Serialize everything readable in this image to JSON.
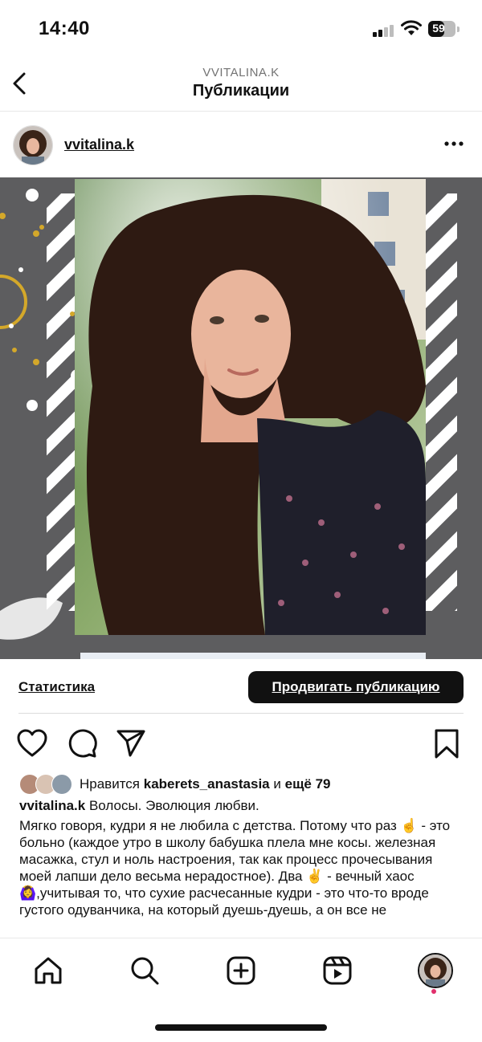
{
  "status_bar": {
    "time": "14:40",
    "battery": "59"
  },
  "nav": {
    "subtitle": "VVITALINA.K",
    "title": "Публикации"
  },
  "post": {
    "username": "vvitalina.k",
    "statistics_label": "Статистика",
    "promote_label": "Продвигать публикацию",
    "likes_prefix": "Нравится",
    "likes_user": "kaberets_anastasia",
    "likes_and": "и",
    "likes_more": "ещё 79",
    "caption_user": "vvitalina.k",
    "caption_title": "Волосы. Эволюция любви.",
    "caption_body": "Мягко говоря, кудри я не любила с детства. Потому что раз ☝️ - это больно (каждое утро в школу бабушка плела мне косы. железная масажка, стул и ноль настроения, так как процесс прочесывания моей лапши дело весьма нерадостное). Два ✌️ - вечный хаос 🙆‍♀️,учитывая то, что сухие расчесанные кудри - это что-то вроде густого одуванчика, на который дуешь-дуешь, а он все не"
  },
  "icons": [
    "back-chevron-icon",
    "more-options-icon",
    "heart-icon",
    "comment-icon",
    "share-icon",
    "bookmark-icon",
    "home-icon",
    "search-icon",
    "create-icon",
    "reels-icon",
    "profile-icon"
  ],
  "colors": {
    "accent_dark": "#111111",
    "notification": "#e1306c",
    "frame_gray": "#5d5d5f",
    "frame_gold": "#d4a82a"
  }
}
